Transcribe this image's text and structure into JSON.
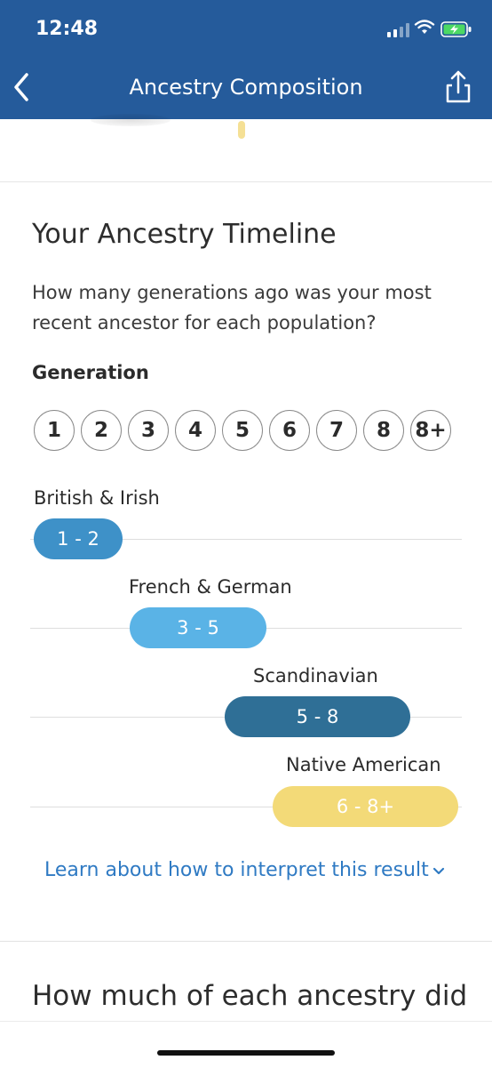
{
  "status_bar": {
    "time": "12:48"
  },
  "nav": {
    "title": "Ancestry Composition",
    "back_icon": "chevron-left-icon",
    "share_icon": "share-icon"
  },
  "timeline": {
    "title": "Your Ancestry Timeline",
    "question": "How many generations ago was your most recent ancestor for each population?",
    "generation_label": "Generation",
    "generations": [
      "1",
      "2",
      "3",
      "4",
      "5",
      "6",
      "7",
      "8",
      "8+"
    ],
    "populations": [
      {
        "name": "British & Irish",
        "range": "1 - 2",
        "color": "#3e91c8"
      },
      {
        "name": "French & German",
        "range": "3 - 5",
        "color": "#5ab3e6"
      },
      {
        "name": "Scandinavian",
        "range": "5 - 8",
        "color": "#2f6f96"
      },
      {
        "name": "Native American",
        "range": "6 - 8+",
        "color": "#f3da78"
      }
    ]
  },
  "learn_link": "Learn about how to interpret this result",
  "next_section_title": "How much of each ancestry did"
}
